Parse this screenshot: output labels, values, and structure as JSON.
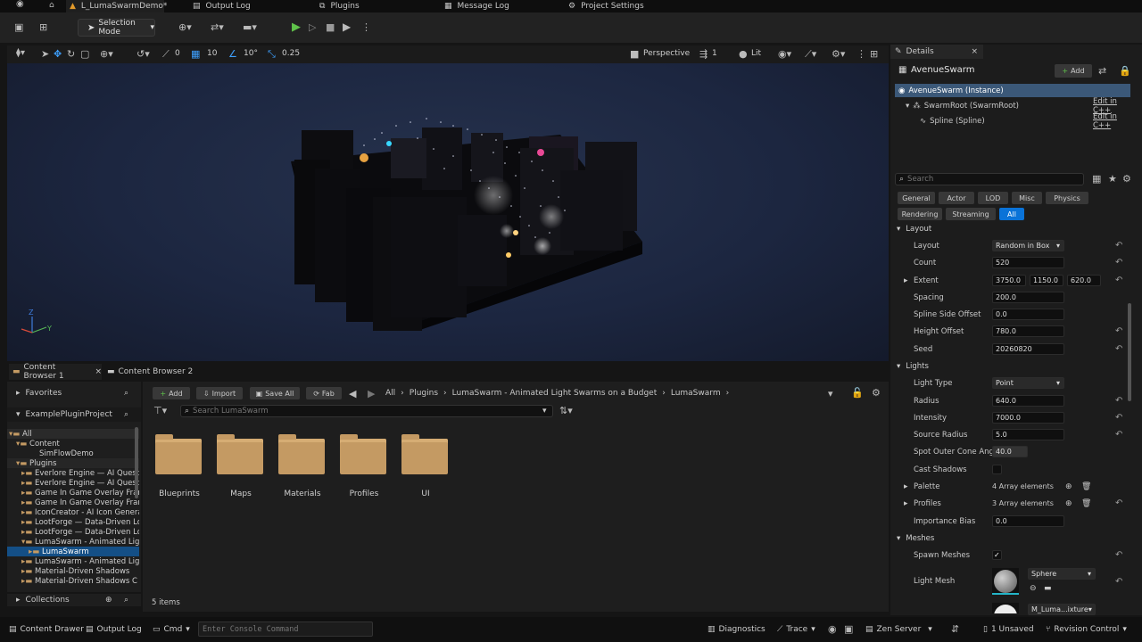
{
  "tabs": {
    "level": "L_LumaSwarmDemo*",
    "output_log": "Output Log",
    "plugins": "Plugins",
    "message_log": "Message Log",
    "project_settings": "Project Settings"
  },
  "toolbar": {
    "selection_mode": "Selection Mode"
  },
  "viewport": {
    "view": "Perspective",
    "lit": "Lit",
    "cam_speed": "1",
    "translate_snap": "10",
    "rotate_snap": "10°",
    "scale_snap": "0.25",
    "surface": "0",
    "axis_z": "Z",
    "axis_y": "Y"
  },
  "content_browser": {
    "tab1": "Content Browser 1",
    "tab2": "Content Browser 2",
    "favorites": "Favorites",
    "project": "ExamplePluginProject",
    "add": "Add",
    "import": "Import",
    "save_all": "Save All",
    "fab": "Fab",
    "path": [
      "All",
      "Plugins",
      "LumaSwarm - Animated Light Swarms on a Budget",
      "LumaSwarm"
    ],
    "search_placeholder": "Search LumaSwarm",
    "tree": [
      "All",
      "Content",
      "SimFlowDemo",
      "Plugins",
      "Everlore Engine — AI Quest a",
      "Everlore Engine — AI Quest a",
      "Game In Game Overlay Fran",
      "Game In Game Overlay Fran",
      "IconCreator - AI Icon Genera",
      "LootForge — Data-Driven Lo",
      "LootForge — Data-Driven Lo",
      "LumaSwarm - Animated Lig",
      "LumaSwarm",
      "LumaSwarm - Animated Lig",
      "Material-Driven Shadows",
      "Material-Driven Shadows C"
    ],
    "collections": "Collections",
    "folders": [
      "Blueprints",
      "Maps",
      "Materials",
      "Profiles",
      "UI"
    ],
    "item_count": "5 items"
  },
  "details": {
    "tab": "Details",
    "actor": "AvenueSwarm",
    "add": "Add",
    "instance": "AvenueSwarm (Instance)",
    "root": "SwarmRoot (SwarmRoot)",
    "spline": "Spline (Spline)",
    "edit_cpp": "Edit in C++",
    "search_placeholder": "Search",
    "filters": [
      "General",
      "Actor",
      "LOD",
      "Misc",
      "Physics",
      "Rendering",
      "Streaming",
      "All"
    ],
    "sections": {
      "layout": "Layout",
      "lights": "Lights",
      "meshes": "Meshes"
    },
    "layout_props": [
      {
        "label": "Layout",
        "value": "Random in Box"
      },
      {
        "label": "Count",
        "value": "520"
      },
      {
        "label": "Extent",
        "value": "3750.0",
        "value2": "1150.0",
        "value3": "620.0"
      },
      {
        "label": "Spacing",
        "value": "200.0"
      },
      {
        "label": "Spline Side Offset",
        "value": "0.0"
      },
      {
        "label": "Height Offset",
        "value": "780.0"
      },
      {
        "label": "Seed",
        "value": "20260820"
      }
    ],
    "light_props": [
      {
        "label": "Light Type",
        "value": "Point"
      },
      {
        "label": "Radius",
        "value": "640.0"
      },
      {
        "label": "Intensity",
        "value": "7000.0"
      },
      {
        "label": "Source Radius",
        "value": "5.0"
      },
      {
        "label": "Spot Outer Cone Angle",
        "value": "40.0"
      },
      {
        "label": "Cast Shadows",
        "value": ""
      },
      {
        "label": "Palette",
        "value": "4 Array elements"
      },
      {
        "label": "Profiles",
        "value": "3 Array elements"
      },
      {
        "label": "Importance Bias",
        "value": "0.0"
      }
    ],
    "mesh_props": {
      "spawn": "Spawn Meshes",
      "light_mesh": "Light Mesh",
      "mesh_value": "Sphere",
      "material_value": "M_Luma...ixture"
    }
  },
  "status": {
    "drawer": "Content Drawer",
    "output_log": "Output Log",
    "cmd": "Cmd",
    "console_placeholder": "Enter Console Command",
    "diagnostics": "Diagnostics",
    "trace": "Trace",
    "zen": "Zen Server",
    "unsaved": "1 Unsaved",
    "revision": "Revision Control"
  }
}
